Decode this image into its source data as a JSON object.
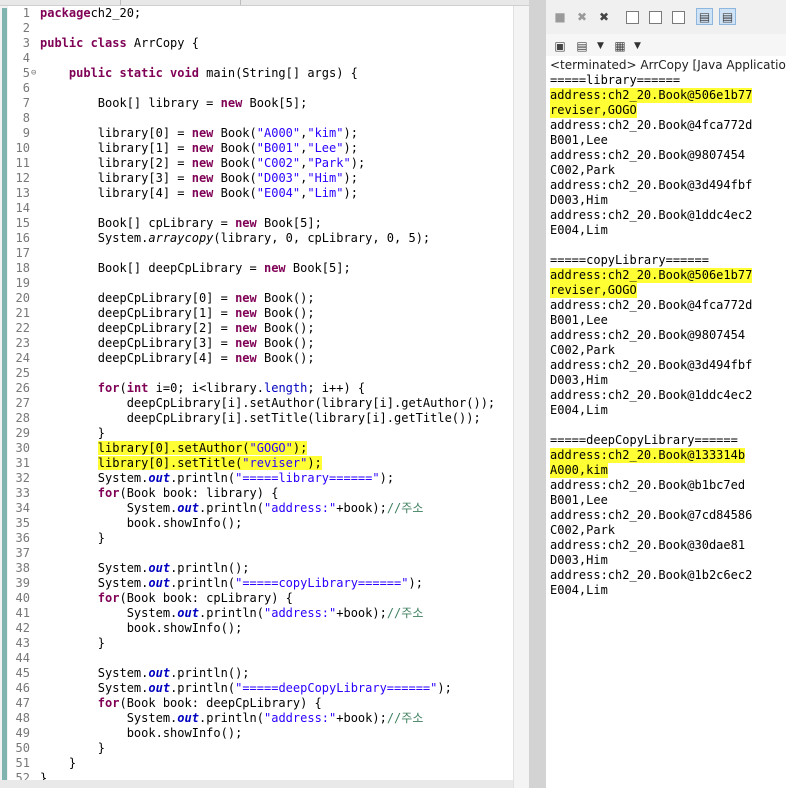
{
  "colors": {
    "highlight": "#ffff33",
    "keyword": "#7f0055",
    "string": "#2a00ff",
    "field": "#0000c0",
    "comment": "#3f7f5f"
  },
  "line_numbers": [
    "1",
    "2",
    "3",
    "4",
    "5",
    "6",
    "7",
    "8",
    "9",
    "10",
    "11",
    "12",
    "13",
    "14",
    "15",
    "16",
    "17",
    "18",
    "19",
    "20",
    "21",
    "22",
    "23",
    "24",
    "25",
    "26",
    "27",
    "28",
    "29",
    "30",
    "31",
    "32",
    "33",
    "34",
    "35",
    "36",
    "37",
    "38",
    "39",
    "40",
    "41",
    "42",
    "43",
    "44",
    "45",
    "46",
    "47",
    "48",
    "49",
    "50",
    "51",
    "52"
  ],
  "fold_marker": "⊖",
  "console": {
    "status": "<terminated> ArrCopy [Java Application] C:\\",
    "toolbar_icons": [
      "terminate-icon",
      "remove-launch-icon",
      "remove-all-icon",
      "clear-console-icon",
      "scroll-lock-icon",
      "word-wrap-icon",
      "show-on-stdout-icon",
      "show-on-stderr-icon",
      "pin-console-icon",
      "display-console-icon",
      "open-console-icon"
    ],
    "output": [
      "=====library======",
      "address:ch2_20.Book@506e1b77",
      "reviser,GOGO",
      "address:ch2_20.Book@4fca772d",
      "B001,Lee",
      "address:ch2_20.Book@9807454",
      "C002,Park",
      "address:ch2_20.Book@3d494fbf",
      "D003,Him",
      "address:ch2_20.Book@1ddc4ec2",
      "E004,Lim",
      "",
      "=====copyLibrary======",
      "address:ch2_20.Book@506e1b77",
      "reviser,GOGO",
      "address:ch2_20.Book@4fca772d",
      "B001,Lee",
      "address:ch2_20.Book@9807454",
      "C002,Park",
      "address:ch2_20.Book@3d494fbf",
      "D003,Him",
      "address:ch2_20.Book@1ddc4ec2",
      "E004,Lim",
      "",
      "=====deepCopyLibrary======",
      "address:ch2_20.Book@133314b",
      "A000,kim",
      "address:ch2_20.Book@b1bc7ed",
      "B001,Lee",
      "address:ch2_20.Book@7cd84586",
      "C002,Park",
      "address:ch2_20.Book@30dae81",
      "D003,Him",
      "address:ch2_20.Book@1b2c6ec2",
      "E004,Lim"
    ],
    "highlighted_output_lines": [
      1,
      2,
      13,
      14,
      25,
      26
    ]
  },
  "code_lines": [
    [
      [
        "kw",
        "package"
      ],
      [
        "",
        "ch2_20;"
      ]
    ],
    [],
    [
      [
        "kw",
        "public class"
      ],
      [
        "",
        " ArrCopy {"
      ]
    ],
    [],
    [
      [
        "",
        "    "
      ],
      [
        "kw",
        "public static void"
      ],
      [
        "",
        " main(String[] args) {"
      ]
    ],
    [],
    [
      [
        "",
        "        Book[] library = "
      ],
      [
        "kw",
        "new"
      ],
      [
        "",
        " Book[5];"
      ]
    ],
    [],
    [
      [
        "",
        "        library[0] = "
      ],
      [
        "kw",
        "new"
      ],
      [
        "",
        " Book("
      ],
      [
        "str",
        "\"A000\""
      ],
      [
        "",
        ","
      ],
      [
        "str",
        "\"kim\""
      ],
      [
        "",
        ");"
      ]
    ],
    [
      [
        "",
        "        library[1] = "
      ],
      [
        "kw",
        "new"
      ],
      [
        "",
        " Book("
      ],
      [
        "str",
        "\"B001\""
      ],
      [
        "",
        ","
      ],
      [
        "str",
        "\"Lee\""
      ],
      [
        "",
        ");"
      ]
    ],
    [
      [
        "",
        "        library[2] = "
      ],
      [
        "kw",
        "new"
      ],
      [
        "",
        " Book("
      ],
      [
        "str",
        "\"C002\""
      ],
      [
        "",
        ","
      ],
      [
        "str",
        "\"Park\""
      ],
      [
        "",
        ");"
      ]
    ],
    [
      [
        "",
        "        library[3] = "
      ],
      [
        "kw",
        "new"
      ],
      [
        "",
        " Book("
      ],
      [
        "str",
        "\"D003\""
      ],
      [
        "",
        ","
      ],
      [
        "str",
        "\"Him\""
      ],
      [
        "",
        ");"
      ]
    ],
    [
      [
        "",
        "        library[4] = "
      ],
      [
        "kw",
        "new"
      ],
      [
        "",
        " Book("
      ],
      [
        "str",
        "\"E004\""
      ],
      [
        "",
        ","
      ],
      [
        "str",
        "\"Lim\""
      ],
      [
        "",
        ");"
      ]
    ],
    [],
    [
      [
        "",
        "        Book[] cpLibrary = "
      ],
      [
        "kw",
        "new"
      ],
      [
        "",
        " Book[5];"
      ]
    ],
    [
      [
        "",
        "        System."
      ],
      [
        "static",
        "arraycopy"
      ],
      [
        "",
        "(library, 0, cpLibrary, 0, 5);"
      ]
    ],
    [],
    [
      [
        "",
        "        Book[] deepCpLibrary = "
      ],
      [
        "kw",
        "new"
      ],
      [
        "",
        " Book[5];"
      ]
    ],
    [],
    [
      [
        "",
        "        deepCpLibrary[0] = "
      ],
      [
        "kw",
        "new"
      ],
      [
        "",
        " Book();"
      ]
    ],
    [
      [
        "",
        "        deepCpLibrary[1] = "
      ],
      [
        "kw",
        "new"
      ],
      [
        "",
        " Book();"
      ]
    ],
    [
      [
        "",
        "        deepCpLibrary[2] = "
      ],
      [
        "kw",
        "new"
      ],
      [
        "",
        " Book();"
      ]
    ],
    [
      [
        "",
        "        deepCpLibrary[3] = "
      ],
      [
        "kw",
        "new"
      ],
      [
        "",
        " Book();"
      ]
    ],
    [
      [
        "",
        "        deepCpLibrary[4] = "
      ],
      [
        "kw",
        "new"
      ],
      [
        "",
        " Book();"
      ]
    ],
    [],
    [
      [
        "",
        "        "
      ],
      [
        "kw",
        "for"
      ],
      [
        "",
        "("
      ],
      [
        "kw",
        "int"
      ],
      [
        "",
        " i=0; i<library."
      ],
      [
        "fld",
        "length"
      ],
      [
        "",
        "; i++) {"
      ]
    ],
    [
      [
        "",
        "            deepCpLibrary[i].setAuthor(library[i].getAuthor());"
      ]
    ],
    [
      [
        "",
        "            deepCpLibrary[i].setTitle(library[i].getTitle());"
      ]
    ],
    [
      [
        "",
        "        }"
      ]
    ],
    [
      [
        "",
        "        "
      ],
      [
        "hl",
        "library[0].setAuthor("
      ],
      [
        "hlstr",
        "\"GOGO\""
      ],
      [
        "hl",
        ");"
      ]
    ],
    [
      [
        "",
        "        "
      ],
      [
        "hl",
        "library[0].setTitle("
      ],
      [
        "hlstr",
        "\"reviser\""
      ],
      [
        "hl",
        ");"
      ]
    ],
    [
      [
        "",
        "        System."
      ],
      [
        "fldstat",
        "out"
      ],
      [
        "",
        ".println("
      ],
      [
        "str",
        "\"=====library======\""
      ],
      [
        "",
        ");"
      ]
    ],
    [
      [
        "",
        "        "
      ],
      [
        "kw",
        "for"
      ],
      [
        "",
        "(Book book: library) {"
      ]
    ],
    [
      [
        "",
        "            System."
      ],
      [
        "fldstat",
        "out"
      ],
      [
        "",
        ".println("
      ],
      [
        "str",
        "\"address:\""
      ],
      [
        "",
        "+book);"
      ],
      [
        "cmt",
        "//주소"
      ]
    ],
    [
      [
        "",
        "            book.showInfo();"
      ]
    ],
    [
      [
        "",
        "        }"
      ]
    ],
    [],
    [
      [
        "",
        "        System."
      ],
      [
        "fldstat",
        "out"
      ],
      [
        "",
        ".println();"
      ]
    ],
    [
      [
        "",
        "        System."
      ],
      [
        "fldstat",
        "out"
      ],
      [
        "",
        ".println("
      ],
      [
        "str",
        "\"=====copyLibrary======\""
      ],
      [
        "",
        ");"
      ]
    ],
    [
      [
        "",
        "        "
      ],
      [
        "kw",
        "for"
      ],
      [
        "",
        "(Book book: cpLibrary) {"
      ]
    ],
    [
      [
        "",
        "            System."
      ],
      [
        "fldstat",
        "out"
      ],
      [
        "",
        ".println("
      ],
      [
        "str",
        "\"address:\""
      ],
      [
        "",
        "+book);"
      ],
      [
        "cmt",
        "//주소"
      ]
    ],
    [
      [
        "",
        "            book.showInfo();"
      ]
    ],
    [
      [
        "",
        "        }"
      ]
    ],
    [],
    [
      [
        "",
        "        System."
      ],
      [
        "fldstat",
        "out"
      ],
      [
        "",
        ".println();"
      ]
    ],
    [
      [
        "",
        "        System."
      ],
      [
        "fldstat",
        "out"
      ],
      [
        "",
        ".println("
      ],
      [
        "str",
        "\"=====deepCopyLibrary======\""
      ],
      [
        "",
        ");"
      ]
    ],
    [
      [
        "",
        "        "
      ],
      [
        "kw",
        "for"
      ],
      [
        "",
        "(Book book: deepCpLibrary) {"
      ]
    ],
    [
      [
        "",
        "            System."
      ],
      [
        "fldstat",
        "out"
      ],
      [
        "",
        ".println("
      ],
      [
        "str",
        "\"address:\""
      ],
      [
        "",
        "+book);"
      ],
      [
        "cmt",
        "//주소"
      ]
    ],
    [
      [
        "",
        "            book.showInfo();"
      ]
    ],
    [
      [
        "",
        "        }"
      ]
    ],
    [
      [
        "",
        "    }"
      ]
    ],
    [
      [
        "",
        "}"
      ]
    ]
  ]
}
